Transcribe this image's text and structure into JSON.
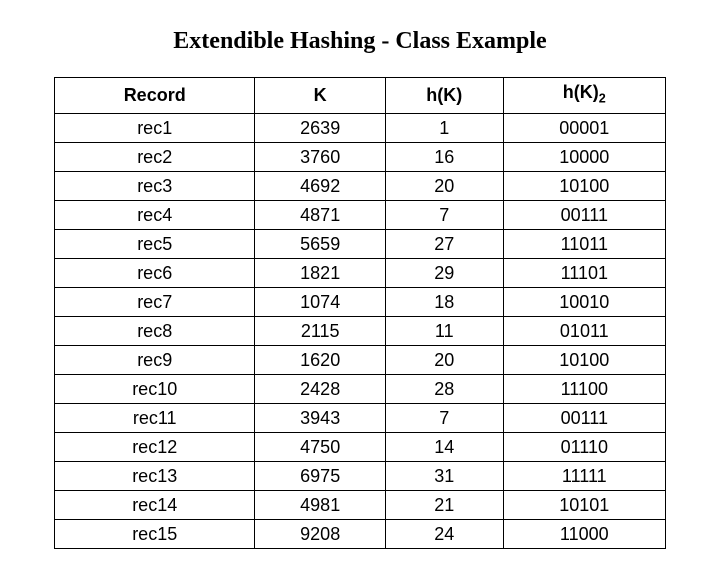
{
  "title": "Extendible Hashing - Class Example",
  "chart_data": {
    "type": "table",
    "headers": {
      "record": "Record",
      "k": "K",
      "hk": "h(K)",
      "hk2_base": "h(K)",
      "hk2_sub": "2"
    },
    "rows": [
      {
        "record": "rec1",
        "k": "2639",
        "hk": "1",
        "hk2": "00001"
      },
      {
        "record": "rec2",
        "k": "3760",
        "hk": "16",
        "hk2": "10000"
      },
      {
        "record": "rec3",
        "k": "4692",
        "hk": "20",
        "hk2": "10100"
      },
      {
        "record": "rec4",
        "k": "4871",
        "hk": "7",
        "hk2": "00111"
      },
      {
        "record": "rec5",
        "k": "5659",
        "hk": "27",
        "hk2": "11011"
      },
      {
        "record": "rec6",
        "k": "1821",
        "hk": "29",
        "hk2": "11101"
      },
      {
        "record": "rec7",
        "k": "1074",
        "hk": "18",
        "hk2": "10010"
      },
      {
        "record": "rec8",
        "k": "2115",
        "hk": "11",
        "hk2": "01011"
      },
      {
        "record": "rec9",
        "k": "1620",
        "hk": "20",
        "hk2": "10100"
      },
      {
        "record": "rec10",
        "k": "2428",
        "hk": "28",
        "hk2": "11100"
      },
      {
        "record": "rec11",
        "k": "3943",
        "hk": "7",
        "hk2": "00111"
      },
      {
        "record": "rec12",
        "k": "4750",
        "hk": "14",
        "hk2": "01110"
      },
      {
        "record": "rec13",
        "k": "6975",
        "hk": "31",
        "hk2": "11111"
      },
      {
        "record": "rec14",
        "k": "4981",
        "hk": "21",
        "hk2": "10101"
      },
      {
        "record": "rec15",
        "k": "9208",
        "hk": "24",
        "hk2": "11000"
      }
    ]
  }
}
